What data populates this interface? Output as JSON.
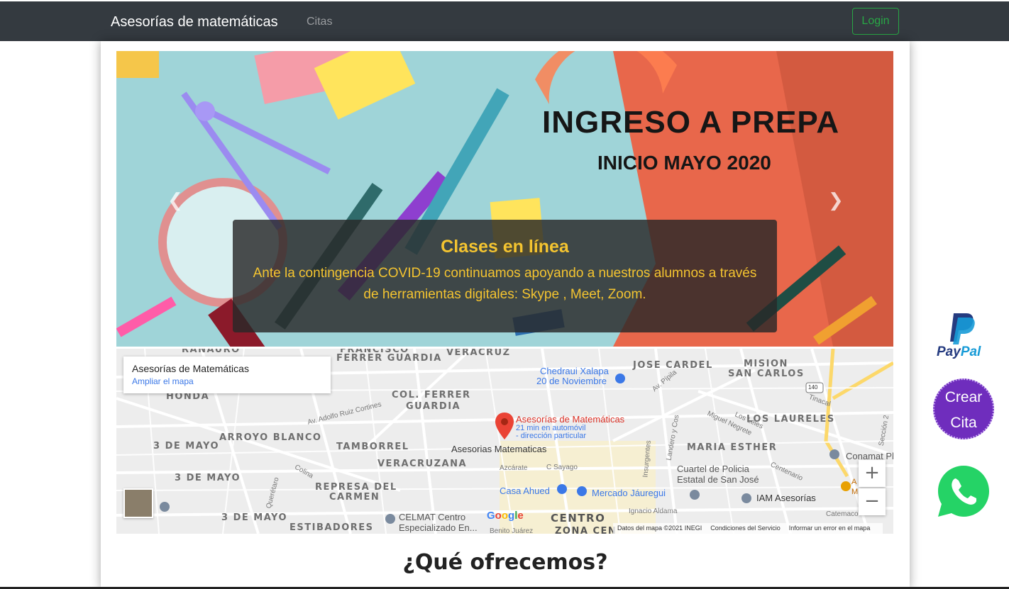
{
  "navbar": {
    "brand": "Asesorías de matemáticas",
    "links": [
      {
        "label": "Citas"
      }
    ],
    "login_label": "Login",
    "login_color": "#28a745"
  },
  "carousel": {
    "banner_title": "INGRESO A PREPA",
    "banner_subtitle": "INICIO MAYO 2020",
    "caption_title": "Clases en línea",
    "caption_text": "Ante la contingencia COVID-19 continuamos apoyando a nuestros alumnos a través de herramientas digitales: Skype , Meet, Zoom.",
    "caption_color": "#f4c430",
    "prev_icon": "chevron-left-icon",
    "next_icon": "chevron-right-icon"
  },
  "map": {
    "info_title": "Asesorías de Matemáticas",
    "info_link": "Ampliar el mapa",
    "marker_title": "Asesorías de Matemáticas",
    "marker_sub1": "21 min en automóvil",
    "marker_sub2": "- dirección particular",
    "neighborhoods": [
      "RANAURO",
      "FRANCISCO",
      "FERRER GUARDIA",
      "VERACRUZ",
      "JOSE CARDEL",
      "MISION",
      "SAN CARLOS",
      "HONDA",
      "COL. FERRER",
      "GUARDIA",
      "LOS LAURELES",
      "ARROYO BLANCO",
      "3 DE MAYO",
      "TAMBORREL",
      "MARIA ESTHER",
      "VERACRUZANA",
      "3 DE MAYO",
      "REPRESA DEL",
      "CARMEN",
      "3 DE MAYO",
      "ESTIBADORES",
      "CENTRO",
      "ZONA CEN"
    ],
    "streets": [
      "Av. Adolfo Ruiz Cortines",
      "Av. Pípila",
      "Miguel Negrete",
      "Los Leles",
      "Landero y Cos",
      "Insurgentes",
      "Azcárate",
      "C Sayago",
      "Ignacio Aldama",
      "Benito Juárez",
      "Colina",
      "Querétaro",
      "Catemaco",
      "Centenario",
      "Tinacal",
      "Sección 2"
    ],
    "pois": [
      {
        "name": "Chedraui Xalapa",
        "extra": "20 de Noviembre"
      },
      {
        "name": "Asesorias Matematicas"
      },
      {
        "name": "Cuartel de Policia",
        "extra": "Estatal de San José"
      },
      {
        "name": "Casa Ahued"
      },
      {
        "name": "Mercado Jáuregui"
      },
      {
        "name": "IAM Asesorías"
      },
      {
        "name": "Conamat Pl"
      },
      {
        "name": "CELMAT Centro",
        "extra": "Especializado En..."
      },
      {
        "name": "A",
        "extra": "M"
      }
    ],
    "google_logo": "Google",
    "attribution": "Datos del mapa ©2021 INEGI",
    "terms": "Condiciones del Servicio",
    "report": "Informar un error en el mapa",
    "zoom_in": "+",
    "zoom_out": "−",
    "route_number": "140"
  },
  "section_title": "¿Qué ofrecemos?",
  "floating": {
    "paypal_label_pay": "Pay",
    "paypal_label_pal": "Pal",
    "crear_line1": "Crear",
    "crear_line2": "Cita",
    "whatsapp_icon": "whatsapp-icon"
  }
}
